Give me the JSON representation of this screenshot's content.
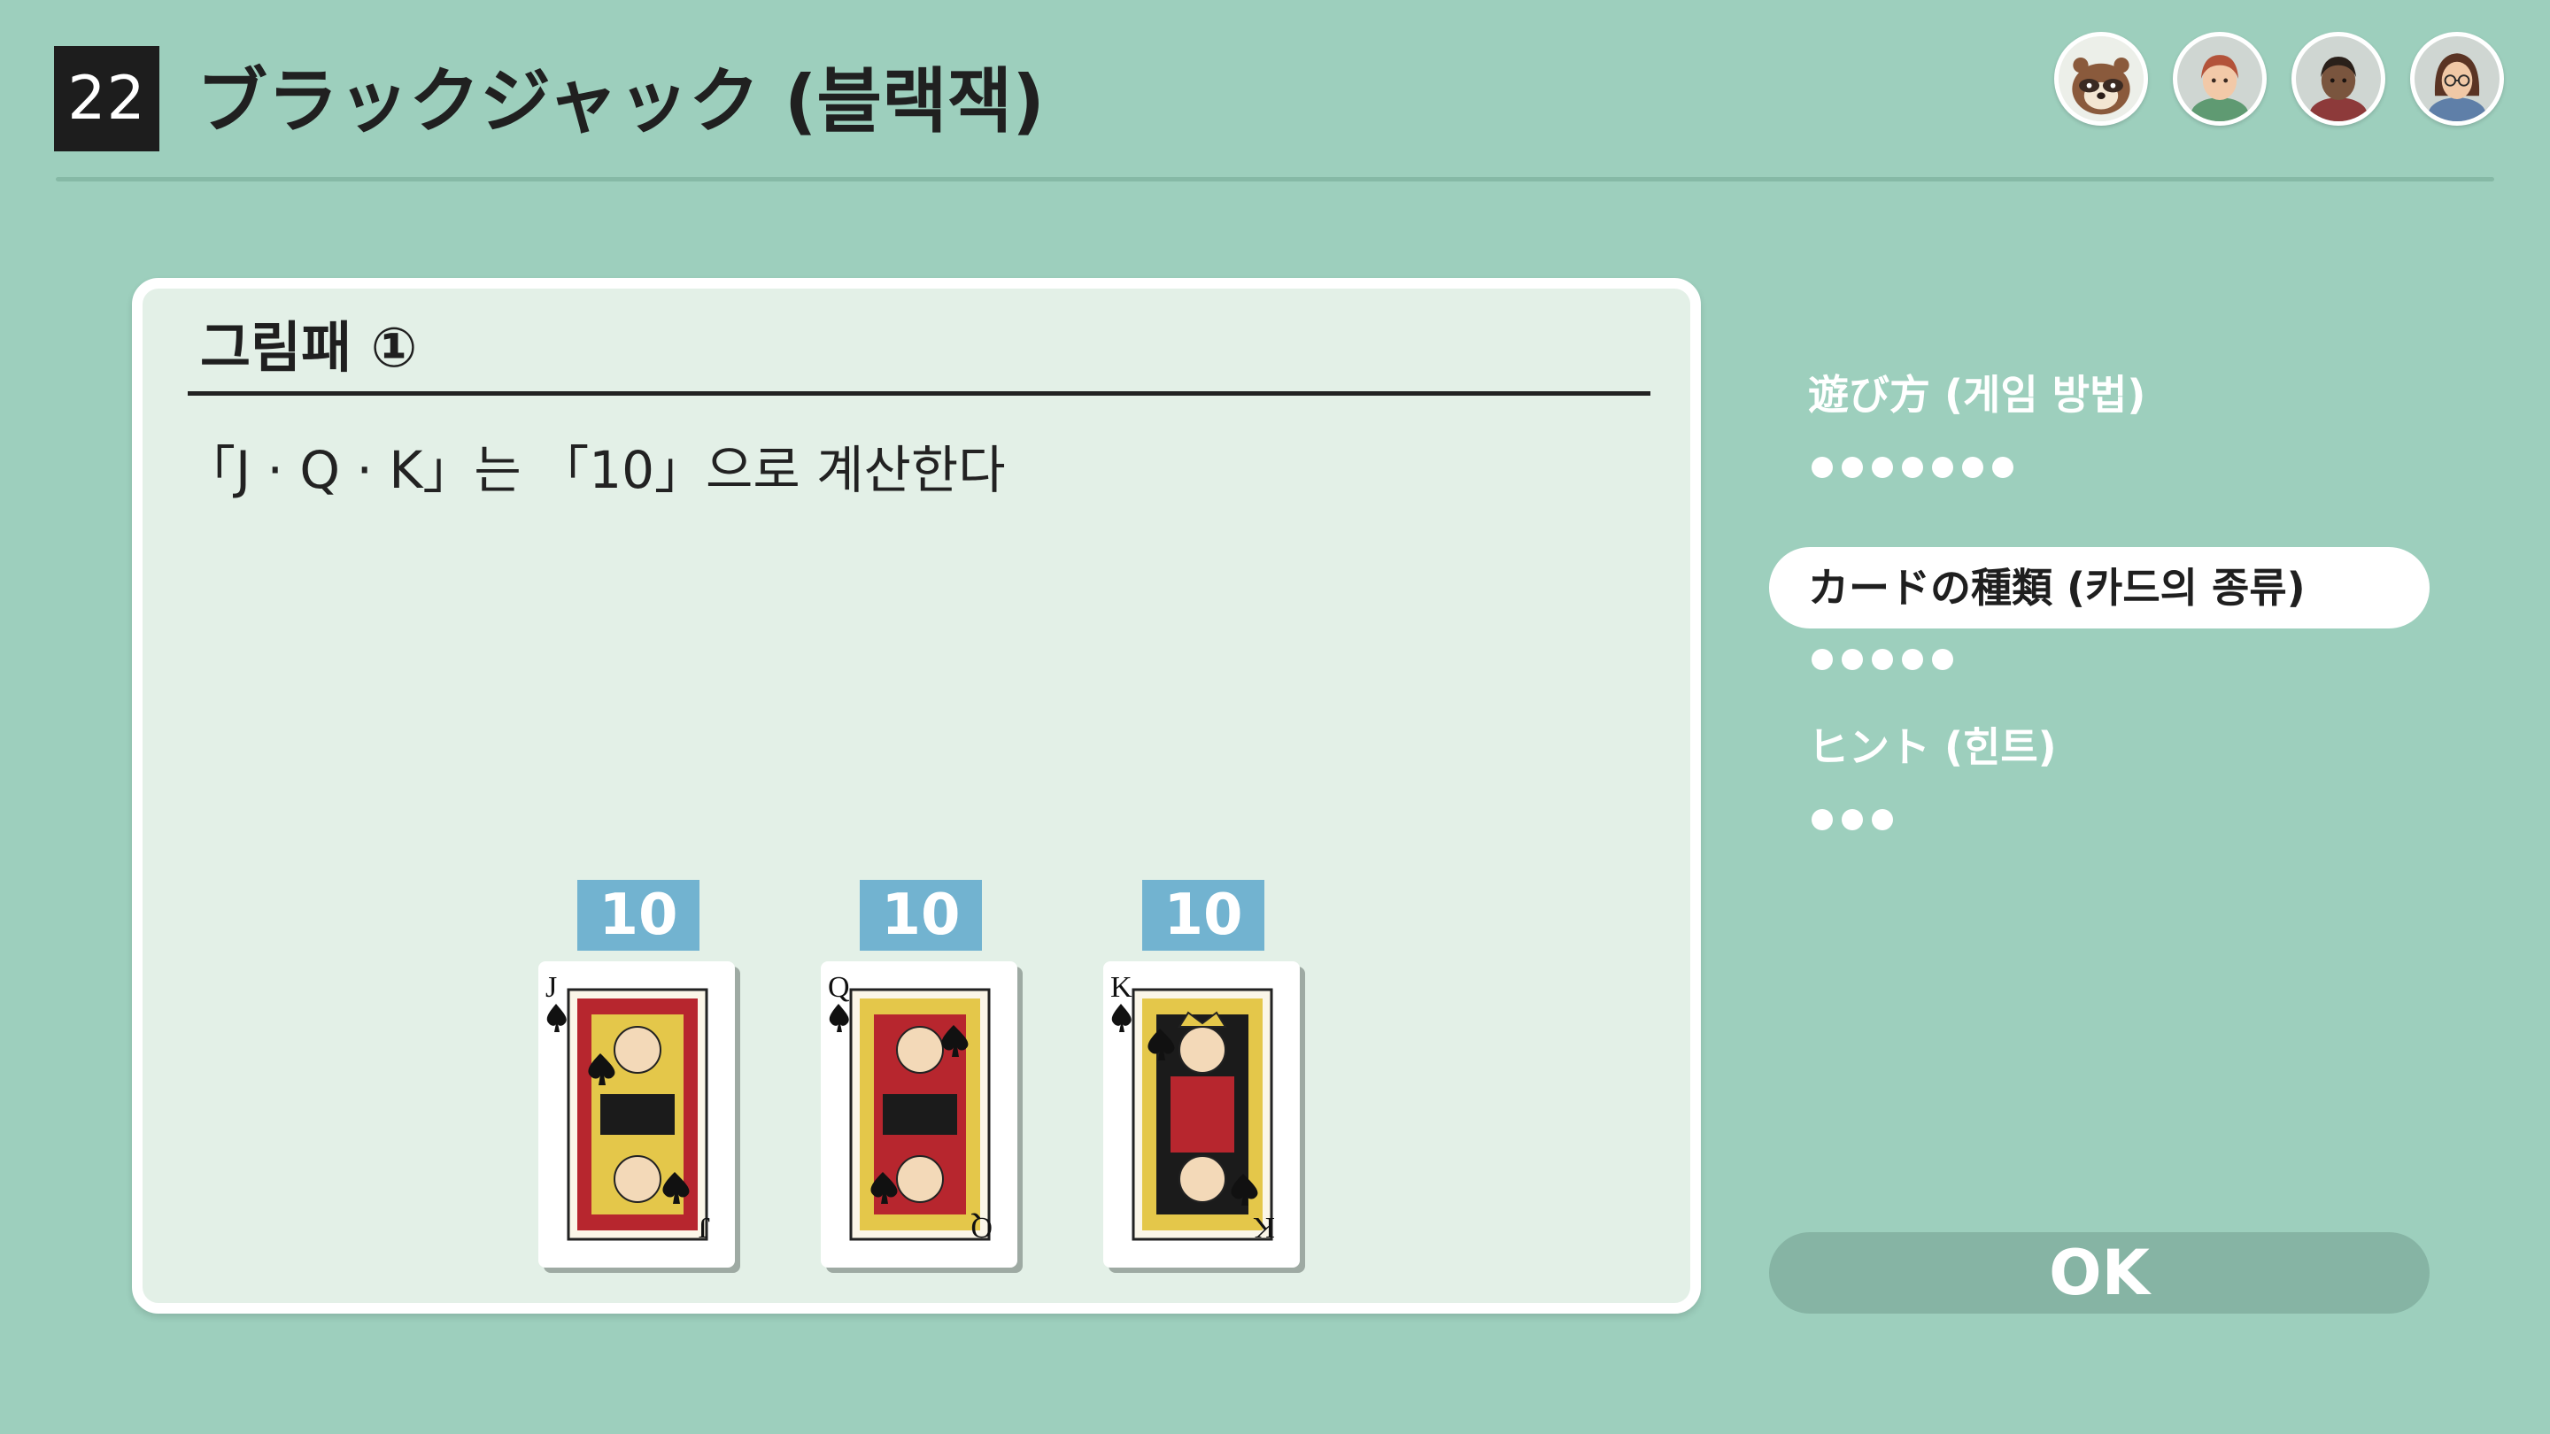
{
  "header": {
    "game_number": "22",
    "title": "ブラックジャック (블랙잭)"
  },
  "players": [
    {
      "icon": "raccoon-avatar-icon"
    },
    {
      "icon": "red-hair-avatar-icon"
    },
    {
      "icon": "dark-skin-avatar-icon"
    },
    {
      "icon": "glasses-avatar-icon"
    }
  ],
  "panel": {
    "heading": "그림패 ①",
    "text": "「J · Q · K」는 「10」으로 계산한다",
    "cards": [
      {
        "rank": "J",
        "suit": "spade",
        "value": "10"
      },
      {
        "rank": "Q",
        "suit": "spade",
        "value": "10"
      },
      {
        "rank": "K",
        "suit": "spade",
        "value": "10"
      }
    ]
  },
  "menu": {
    "items": [
      {
        "label": "遊び方 (게임 방법)",
        "pages": 7,
        "active": false
      },
      {
        "label": "カードの種類 (카드의 종류)",
        "pages": 5,
        "active": true,
        "current_page": 1
      },
      {
        "label": "ヒント (힌트)",
        "pages": 3,
        "active": false
      }
    ]
  },
  "ok_label": "OK",
  "colors": {
    "background": "#9dcfbd",
    "panel": "#e3f0e7",
    "badge": "#72b3d0",
    "ok_button": "#86b4a4"
  }
}
